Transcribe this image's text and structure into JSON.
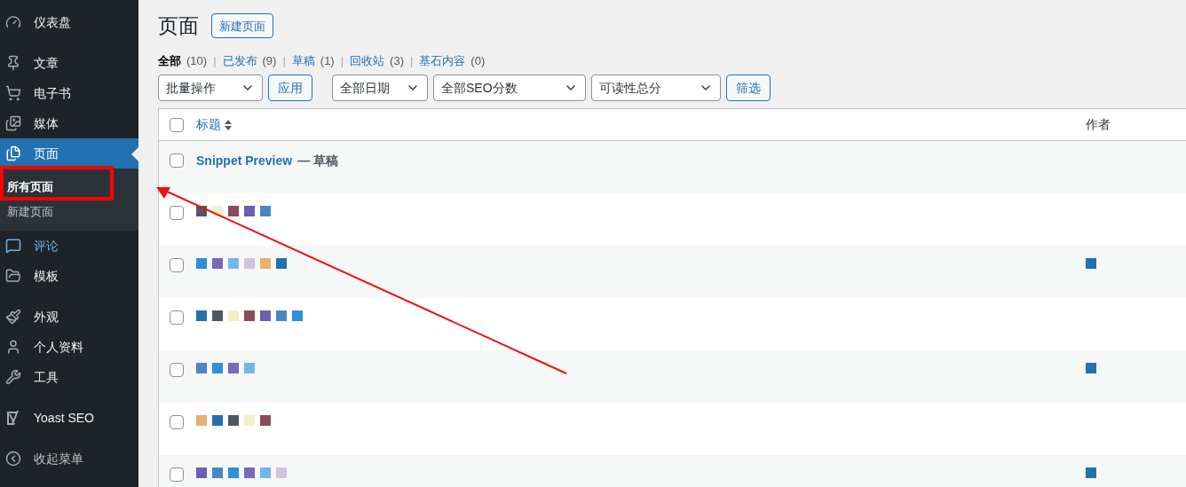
{
  "sidebar": {
    "items": [
      {
        "label": "仪表盘",
        "selected": false,
        "highlighted": false
      },
      {
        "label": "文章",
        "selected": false,
        "highlighted": false
      },
      {
        "label": "电子书",
        "selected": false,
        "highlighted": false
      },
      {
        "label": "媒体",
        "selected": false,
        "highlighted": false
      },
      {
        "label": "页面",
        "selected": true,
        "highlighted": false,
        "children": [
          {
            "label": "所有页面",
            "selected": true
          },
          {
            "label": "新建页面",
            "selected": false
          }
        ]
      },
      {
        "label": "评论",
        "selected": false,
        "highlighted": true
      },
      {
        "label": "模板",
        "selected": false,
        "highlighted": false
      },
      {
        "label": "外观",
        "selected": false,
        "highlighted": false
      },
      {
        "label": "个人资料",
        "selected": false,
        "highlighted": false
      },
      {
        "label": "工具",
        "selected": false,
        "highlighted": false
      },
      {
        "label": "Yoast SEO",
        "selected": false,
        "highlighted": false
      },
      {
        "label": "收起菜单",
        "selected": false,
        "highlighted": false
      }
    ]
  },
  "page": {
    "title": "页面",
    "add_button": "新建页面"
  },
  "filters": [
    {
      "label": "全部",
      "count": "(10)",
      "selected": true
    },
    {
      "separator": "|",
      "label": "已发布",
      "count": "(9)",
      "selected": false
    },
    {
      "separator": "|",
      "label": "草稿",
      "count": "(1)",
      "selected": false
    },
    {
      "separator": "|",
      "label": "回收站",
      "count": "(3)",
      "selected": false
    },
    {
      "separator": "|",
      "label": "基石内容",
      "count": "(0)",
      "selected": false
    }
  ],
  "toolbar": {
    "bulk_action": "批量操作",
    "apply": "应用",
    "dates": "全部日期",
    "seo": "全部SEO分数",
    "readability": "可读性总分",
    "filter": "筛选"
  },
  "table": {
    "select_all_checked": false,
    "columns": [
      "标题",
      "作者"
    ],
    "rows": [
      {
        "kind": "text",
        "title": "Snippet Preview",
        "status": "— 草稿",
        "checked": false
      },
      {
        "kind": "obscured",
        "checked": false
      },
      {
        "kind": "obscured",
        "checked": false
      },
      {
        "kind": "obscured",
        "checked": false
      },
      {
        "kind": "obscured",
        "checked": false
      },
      {
        "kind": "obscured",
        "checked": false
      },
      {
        "kind": "obscured",
        "checked": false
      }
    ]
  }
}
